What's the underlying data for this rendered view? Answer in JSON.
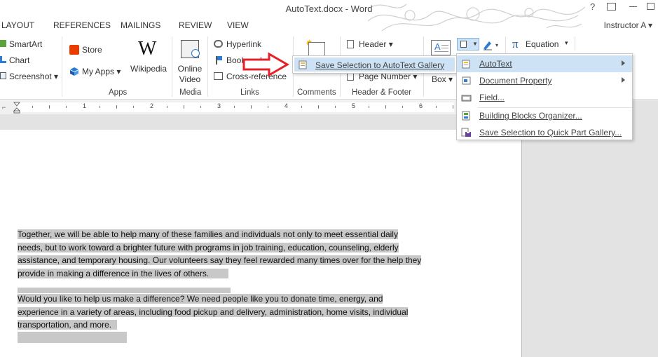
{
  "window": {
    "title": "AutoText.docx - Word",
    "user": "Instructor A"
  },
  "tabs": [
    "LAYOUT",
    "REFERENCES",
    "MAILINGS",
    "REVIEW",
    "VIEW"
  ],
  "ribbon": {
    "illustrations": {
      "smartart": "SmartArt",
      "chart": "Chart",
      "screenshot": "Screenshot"
    },
    "apps": {
      "store": "Store",
      "my_apps": "My Apps",
      "wikipedia": "Wikipedia",
      "group": "Apps"
    },
    "media": {
      "online_video_line1": "Online",
      "online_video_line2": "Video",
      "group": "Media"
    },
    "links": {
      "hyperlink": "Hyperlink",
      "bookmark": "Bookmark",
      "crossref": "Cross-reference",
      "group": "Links"
    },
    "comments": {
      "group": "Comments"
    },
    "header_footer": {
      "header": "Header",
      "page_number": "Page Number",
      "group": "Header & Footer"
    },
    "text": {
      "box": "Box"
    },
    "symbols": {
      "equation": "Equation"
    }
  },
  "ruler": {
    "numbers": [
      "1",
      "2",
      "3",
      "4",
      "5",
      "6"
    ]
  },
  "document": {
    "para1": [
      "Together, we will be able to help many of these families and individuals not only to meet essential daily",
      "needs, but to work toward a brighter future with programs in job training, education, counseling, elderly",
      "assistance, and temporary housing. Our volunteers say they feel rewarded many times over for the help they",
      "provide in making a difference in the lives of others."
    ],
    "para2": [
      "Would you like to help us make a difference? We need people like you to donate time, energy, and",
      "experience in a variety of areas, including food pickup and delivery, administration, home visits, individual",
      "transportation, and more."
    ]
  },
  "quick_parts_menu": {
    "items": [
      {
        "label": "AutoText"
      },
      {
        "label": "Document Property"
      },
      {
        "label": "Field..."
      },
      {
        "label": "Building Blocks Organizer..."
      },
      {
        "label": "Save Selection to Quick Part Gallery..."
      }
    ]
  },
  "autotext_submenu": {
    "label": "Save Selection to AutoText Gallery"
  },
  "colors": {
    "highlight": "#cde2f4",
    "selection": "#c8c8c8",
    "arrow": "#e8202a"
  }
}
